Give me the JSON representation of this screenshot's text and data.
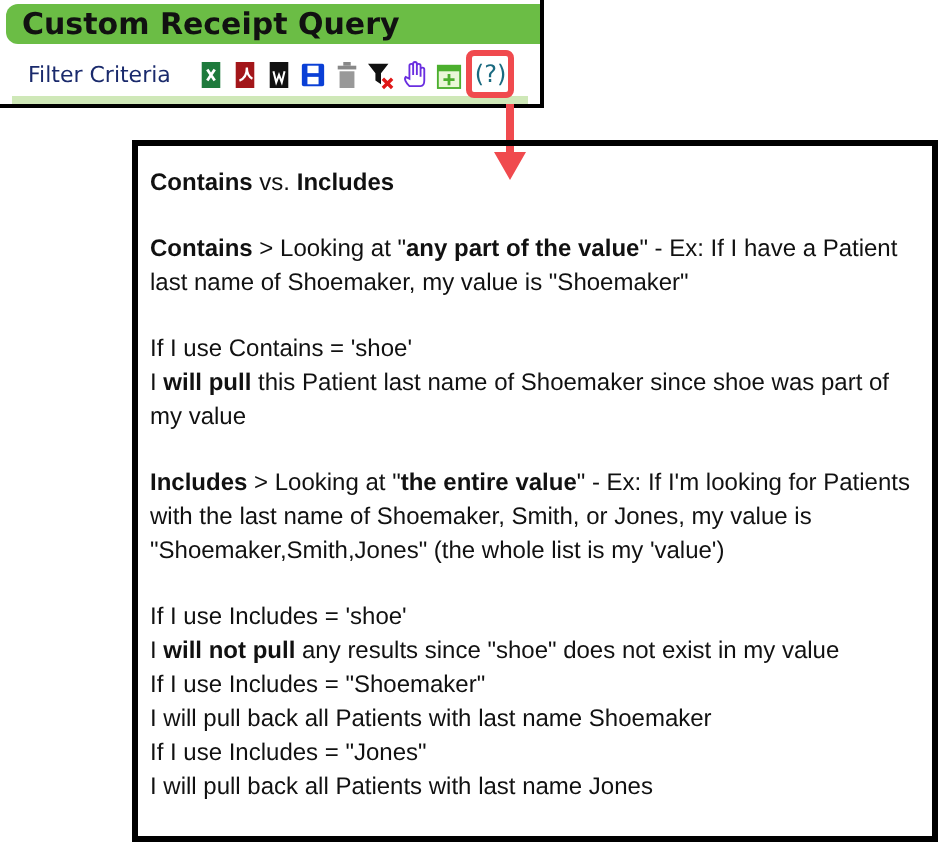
{
  "panel": {
    "title": "Custom Receipt Query",
    "filter_label": "Filter Criteria",
    "toolbar_icons": [
      {
        "kind": "excel"
      },
      {
        "kind": "pdf"
      },
      {
        "kind": "word"
      },
      {
        "kind": "save"
      },
      {
        "kind": "trash"
      },
      {
        "kind": "filter-clear"
      },
      {
        "kind": "hand"
      },
      {
        "kind": "calendar-add"
      }
    ],
    "help_link": "(?)"
  },
  "callout": {
    "blocks": [
      [
        "**Contains** vs. **Includes**"
      ],
      [
        "**Contains** > Looking at \"**any part of the value**\" - Ex: If I have a Patient last name of Shoemaker, my value is \"Shoemaker\""
      ],
      [
        "If I use Contains = 'shoe'",
        "I **will pull** this Patient last name of Shoemaker since shoe was part of my value"
      ],
      [
        "**Includes** > Looking at \"**the entire value**\" - Ex: If I'm looking for Patients with the last name of Shoemaker, Smith, or Jones, my value is \"Shoemaker,Smith,Jones\" (the whole list is my 'value')"
      ],
      [
        "If I use Includes = 'shoe'",
        "I **will not pull** any results since \"shoe\" does not exist in my value",
        "If I use Includes = \"Shoemaker\"",
        "I will pull back all Patients with last name Shoemaker",
        "If I use Includes = \"Jones\"",
        "I will pull back all Patients with last name Jones"
      ]
    ]
  }
}
